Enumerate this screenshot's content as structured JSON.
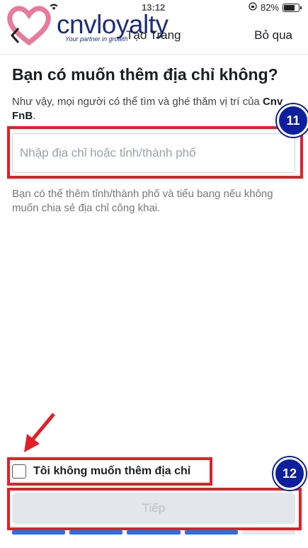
{
  "status_bar": {
    "time": "13:12",
    "battery_percent": "82%",
    "battery_level": 0.82
  },
  "logo": {
    "text": "cnvloyalty",
    "tagline": "Your partner in growth"
  },
  "nav": {
    "title": "Tạo Trang",
    "back_icon": "chevron-left-icon",
    "skip_label": "Bỏ qua"
  },
  "content": {
    "heading": "Bạn có muốn thêm địa chỉ không?",
    "description_prefix": "Như vậy, mọi người có thể tìm và ghé thăm vị trí của",
    "page_name": "Cnv FnB",
    "description_suffix": ".",
    "address_placeholder": "Nhập địa chỉ hoặc tỉnh/thành phố",
    "address_value": "",
    "hint": "Bạn có thể thêm tỉnh/thành phố và tiểu bang nếu không muốn chia sẻ địa chỉ công khai."
  },
  "checkbox": {
    "label": "Tôi không muốn thêm địa chỉ",
    "checked": false
  },
  "next_button": {
    "label": "Tiếp",
    "enabled": false
  },
  "progress": {
    "total_steps": 5,
    "completed_steps": 4
  },
  "annotations": {
    "badge_1": "11",
    "badge_2": "12",
    "highlight_color": "#e41e26",
    "badge_color": "#0d1f9e"
  }
}
